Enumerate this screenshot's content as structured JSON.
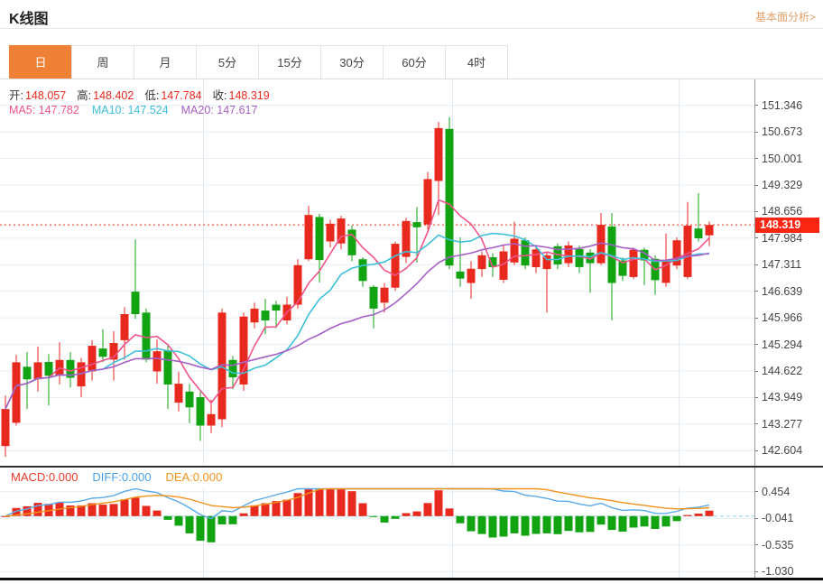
{
  "header": {
    "title": "K线图",
    "link_label": "基本面分析>"
  },
  "tabs": [
    {
      "key": "day",
      "label": "日",
      "active": true
    },
    {
      "key": "week",
      "label": "周",
      "active": false
    },
    {
      "key": "month",
      "label": "月",
      "active": false
    },
    {
      "key": "min5",
      "label": "5分",
      "active": false
    },
    {
      "key": "min15",
      "label": "15分",
      "active": false
    },
    {
      "key": "min30",
      "label": "30分",
      "active": false
    },
    {
      "key": "min60",
      "label": "60分",
      "active": false
    },
    {
      "key": "hour4",
      "label": "4时",
      "active": false
    }
  ],
  "indicators": {
    "ohlc": [
      {
        "label": "开:",
        "value": "148.057"
      },
      {
        "label": "高:",
        "value": "148.402"
      },
      {
        "label": "低:",
        "value": "147.784"
      },
      {
        "label": "收:",
        "value": "148.319"
      }
    ],
    "ma": [
      {
        "label": "MA5:",
        "value": "147.782",
        "color": "#f0548c"
      },
      {
        "label": "MA10:",
        "value": "147.524",
        "color": "#3ec0d8"
      },
      {
        "label": "MA20:",
        "value": "147.617",
        "color": "#a75fc8"
      }
    ],
    "macd": [
      {
        "label": "MACD:",
        "value": "0.000",
        "color": "#e83a28"
      },
      {
        "label": "DIFF:",
        "value": "0.000",
        "color": "#4aa0e8"
      },
      {
        "label": "DEA:",
        "value": "0.000",
        "color": "#f5941e"
      }
    ]
  },
  "chart_data": {
    "type": "candlestick",
    "title": "K线图 (daily JPY-style K-line with MA5/MA10/MA20 overlay and MACD sub-chart)",
    "price_axis_labels": [
      "151.346",
      "150.673",
      "150.001",
      "149.329",
      "148.656",
      "147.984",
      "147.311",
      "146.639",
      "145.966",
      "145.294",
      "144.622",
      "143.949",
      "143.277",
      "142.604"
    ],
    "price_axis_range": [
      142.604,
      151.346
    ],
    "current_price": "148.319",
    "macd_axis_labels": [
      "0.454",
      "-0.041",
      "-0.535",
      "-1.030"
    ],
    "macd_axis_range": [
      -1.03,
      0.454
    ],
    "ma_periods": [
      5,
      10,
      20
    ],
    "macd_params": {
      "fast": 12,
      "slow": 26,
      "signal": 9
    },
    "grid": {
      "horizontal": "on",
      "vertical_separators": 3,
      "legend_position": "top-left-overlay"
    },
    "candles_ohlc": [
      [
        142.72,
        144.0,
        142.45,
        143.66
      ],
      [
        143.31,
        145.03,
        143.24,
        144.84
      ],
      [
        144.73,
        145.1,
        143.66,
        144.41
      ],
      [
        144.41,
        145.24,
        144.1,
        144.84
      ],
      [
        144.85,
        145.05,
        143.75,
        144.5
      ],
      [
        144.5,
        145.35,
        144.28,
        144.9
      ],
      [
        144.9,
        145.1,
        144.2,
        144.45
      ],
      [
        144.23,
        144.95,
        143.96,
        144.84
      ],
      [
        144.61,
        145.4,
        144.38,
        145.26
      ],
      [
        145.19,
        145.68,
        144.84,
        144.98
      ],
      [
        144.91,
        145.63,
        144.38,
        145.33
      ],
      [
        145.4,
        146.24,
        144.91,
        146.06
      ],
      [
        146.63,
        147.95,
        145.94,
        146.06
      ],
      [
        146.1,
        146.2,
        144.84,
        144.91
      ],
      [
        144.61,
        145.42,
        144.3,
        145.12
      ],
      [
        145.15,
        145.3,
        143.66,
        144.28
      ],
      [
        143.82,
        144.6,
        143.6,
        144.3
      ],
      [
        144.1,
        144.3,
        143.3,
        143.7
      ],
      [
        143.96,
        144.1,
        142.85,
        143.24
      ],
      [
        143.24,
        143.9,
        143.05,
        143.53
      ],
      [
        143.4,
        146.2,
        143.2,
        146.1
      ],
      [
        144.9,
        145.0,
        144.16,
        144.46
      ],
      [
        144.28,
        146.1,
        144.12,
        146.0
      ],
      [
        145.85,
        146.35,
        145.7,
        146.2
      ],
      [
        146.15,
        146.45,
        145.55,
        145.9
      ],
      [
        146.3,
        146.4,
        145.7,
        146.15
      ],
      [
        145.9,
        146.5,
        145.8,
        146.3
      ],
      [
        146.3,
        147.45,
        146.2,
        147.3
      ],
      [
        147.45,
        148.8,
        147.4,
        148.57
      ],
      [
        148.52,
        148.6,
        146.86,
        147.43
      ],
      [
        147.9,
        148.45,
        147.75,
        148.35
      ],
      [
        147.85,
        148.55,
        147.7,
        148.48
      ],
      [
        148.2,
        148.3,
        147.4,
        147.55
      ],
      [
        147.45,
        147.5,
        146.75,
        146.9
      ],
      [
        146.75,
        146.8,
        145.7,
        146.2
      ],
      [
        146.35,
        146.85,
        146.1,
        146.73
      ],
      [
        146.73,
        147.9,
        146.65,
        147.84
      ],
      [
        147.51,
        148.5,
        147.35,
        148.42
      ],
      [
        148.39,
        148.77,
        147.37,
        148.26
      ],
      [
        148.33,
        149.66,
        148.2,
        149.48
      ],
      [
        149.43,
        150.92,
        148.57,
        150.77
      ],
      [
        150.75,
        151.05,
        147.2,
        147.29
      ],
      [
        147.14,
        148.0,
        146.75,
        146.96
      ],
      [
        146.85,
        147.4,
        146.45,
        147.21
      ],
      [
        147.2,
        147.65,
        147.0,
        147.55
      ],
      [
        147.5,
        147.6,
        147.0,
        147.25
      ],
      [
        146.93,
        147.8,
        146.85,
        147.65
      ],
      [
        147.37,
        148.4,
        147.3,
        147.97
      ],
      [
        147.93,
        148.0,
        147.2,
        147.29
      ],
      [
        147.25,
        147.8,
        147.1,
        147.7
      ],
      [
        147.2,
        147.65,
        146.1,
        147.55
      ],
      [
        147.78,
        147.85,
        147.2,
        147.32
      ],
      [
        147.35,
        147.9,
        147.25,
        147.8
      ],
      [
        147.71,
        147.8,
        147.1,
        147.25
      ],
      [
        147.62,
        147.7,
        146.6,
        147.35
      ],
      [
        147.35,
        148.62,
        147.3,
        148.32
      ],
      [
        148.28,
        148.62,
        145.9,
        146.85
      ],
      [
        147.42,
        147.5,
        146.9,
        147.03
      ],
      [
        147.0,
        147.75,
        146.95,
        147.69
      ],
      [
        147.69,
        147.75,
        146.8,
        147.42
      ],
      [
        147.46,
        147.55,
        146.55,
        146.92
      ],
      [
        146.85,
        148.1,
        146.75,
        147.42
      ],
      [
        147.29,
        148.0,
        147.2,
        147.93
      ],
      [
        147.0,
        148.9,
        146.95,
        148.3
      ],
      [
        148.23,
        149.12,
        147.9,
        147.98
      ],
      [
        148.057,
        148.402,
        147.784,
        148.319
      ]
    ],
    "colors": {
      "up": "#e8291e",
      "down": "#12a312",
      "ma5": "#f0548c",
      "ma10": "#3ec0d8",
      "ma20": "#a75fc8",
      "diff_line": "#5aaae8",
      "dea_line": "#f2921c",
      "price_line": "#fb7a6a",
      "badge_bg": "#fa2513",
      "grid_line": "#e7edf5",
      "vgrid_line": "#e2eaf3",
      "zero_dash": "#8ed7e8",
      "accent_orange": "#ee8135"
    }
  }
}
